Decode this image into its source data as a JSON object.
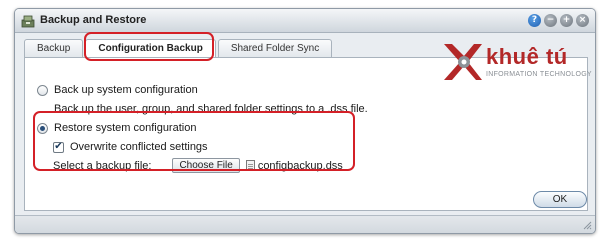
{
  "window": {
    "title": "Backup and Restore",
    "controls": {
      "help": "?",
      "minimize": "−",
      "maximize": "+",
      "close": "×"
    }
  },
  "tabs": [
    {
      "label": "Backup",
      "active": false
    },
    {
      "label": "Configuration Backup",
      "active": true
    },
    {
      "label": "Shared Folder Sync",
      "active": false
    }
  ],
  "backup_option": {
    "label": "Back up system configuration",
    "description": "Back up the user, group, and shared folder settings to a .dss file.",
    "selected": false
  },
  "restore_option": {
    "label": "Restore system configuration",
    "selected": true,
    "overwrite_label": "Overwrite conflicted settings",
    "overwrite_checked": true,
    "file_label": "Select a backup file:",
    "choose_button": "Choose File",
    "file_name": "configbackup.dss"
  },
  "ok_button": "OK",
  "watermark": {
    "name": "khuê tú",
    "tagline": "INFORMATION TECHNOLOGY"
  },
  "colors": {
    "highlight": "#d42027",
    "logo_red": "#b32828"
  }
}
